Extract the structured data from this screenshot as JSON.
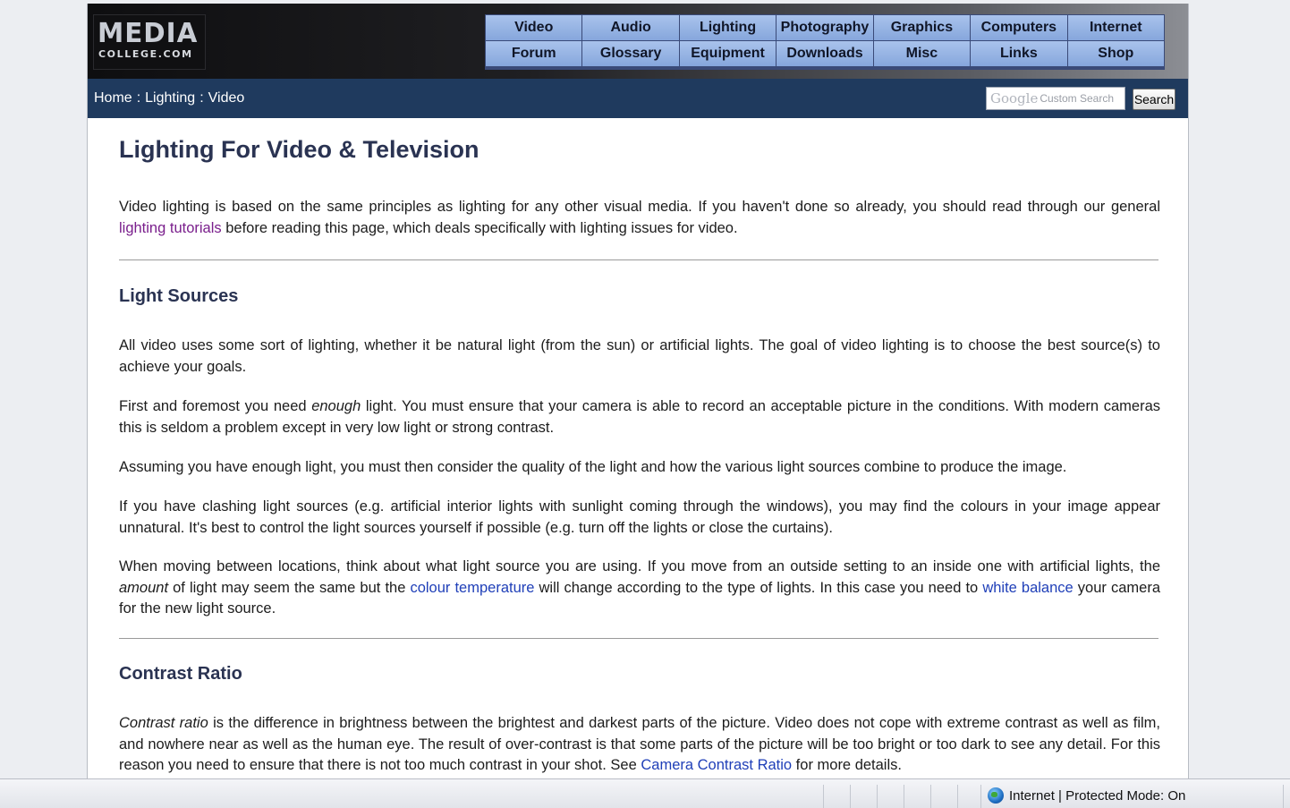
{
  "logo": {
    "main": "MEDIA",
    "sub": "COLLEGE.COM"
  },
  "nav": {
    "items": [
      {
        "label": "Video"
      },
      {
        "label": "Audio"
      },
      {
        "label": "Lighting"
      },
      {
        "label": "Photography"
      },
      {
        "label": "Graphics"
      },
      {
        "label": "Computers"
      },
      {
        "label": "Internet"
      },
      {
        "label": "Forum"
      },
      {
        "label": "Glossary"
      },
      {
        "label": "Equipment"
      },
      {
        "label": "Downloads"
      },
      {
        "label": "Misc"
      },
      {
        "label": "Links"
      },
      {
        "label": "Shop"
      }
    ]
  },
  "breadcrumb": {
    "items": [
      "Home",
      "Lighting",
      "Video"
    ],
    "separator": ":"
  },
  "search": {
    "brand": "Google",
    "placeholder": "Custom Search",
    "button_label": "Search"
  },
  "content": {
    "title": "Lighting For Video & Television",
    "intro": {
      "t1": "Video lighting is based on the same principles as lighting for any other visual media. If you haven't done so already, you should read through our general ",
      "link": "lighting tutorials",
      "t2": " before reading this page, which deals specifically with lighting issues for video."
    },
    "section1": {
      "heading": "Light Sources",
      "p1": "All video uses some sort of lighting, whether it be natural light (from the sun) or artificial lights. The goal of video lighting is to choose the best source(s) to achieve your goals.",
      "p2": {
        "t1": "First and foremost you need ",
        "em": "enough",
        "t2": " light. You must ensure that your camera is able to record an acceptable picture in the conditions. With modern cameras this is seldom a problem except in very low light or strong contrast."
      },
      "p3": "Assuming you have enough light, you must then consider the quality of the light and how the various light sources combine to produce the image.",
      "p4": "If you have clashing light sources (e.g. artificial interior lights with sunlight coming through the windows), you may find the colours in your image appear unnatural. It's best to control the light sources yourself if possible (e.g. turn off the lights or close the curtains).",
      "p5": {
        "t1": "When moving between locations, think about what light source you are using. If you move from an outside setting to an inside one with artificial lights, the ",
        "em": "amount",
        "t2": " of light may seem the same but the ",
        "link1": "colour temperature",
        "t3": " will change according to the type of lights. In this case you need to ",
        "link2": "white balance",
        "t4": " your camera for the new light source."
      }
    },
    "section2": {
      "heading": "Contrast Ratio",
      "p1": {
        "em": "Contrast ratio",
        "t1": " is the difference in brightness between the brightest and darkest parts of the picture. Video does not cope with extreme contrast as well as film, and nowhere near as well as the human eye. The result of over-contrast is that some parts of the picture will be too bright or too dark to see any detail. For this reason you need to ensure that there is not too much contrast in your shot. See ",
        "link": "Camera Contrast Ratio",
        "t2": " for more details."
      }
    }
  },
  "statusbar": {
    "zone": "Internet | Protected Mode: On"
  }
}
